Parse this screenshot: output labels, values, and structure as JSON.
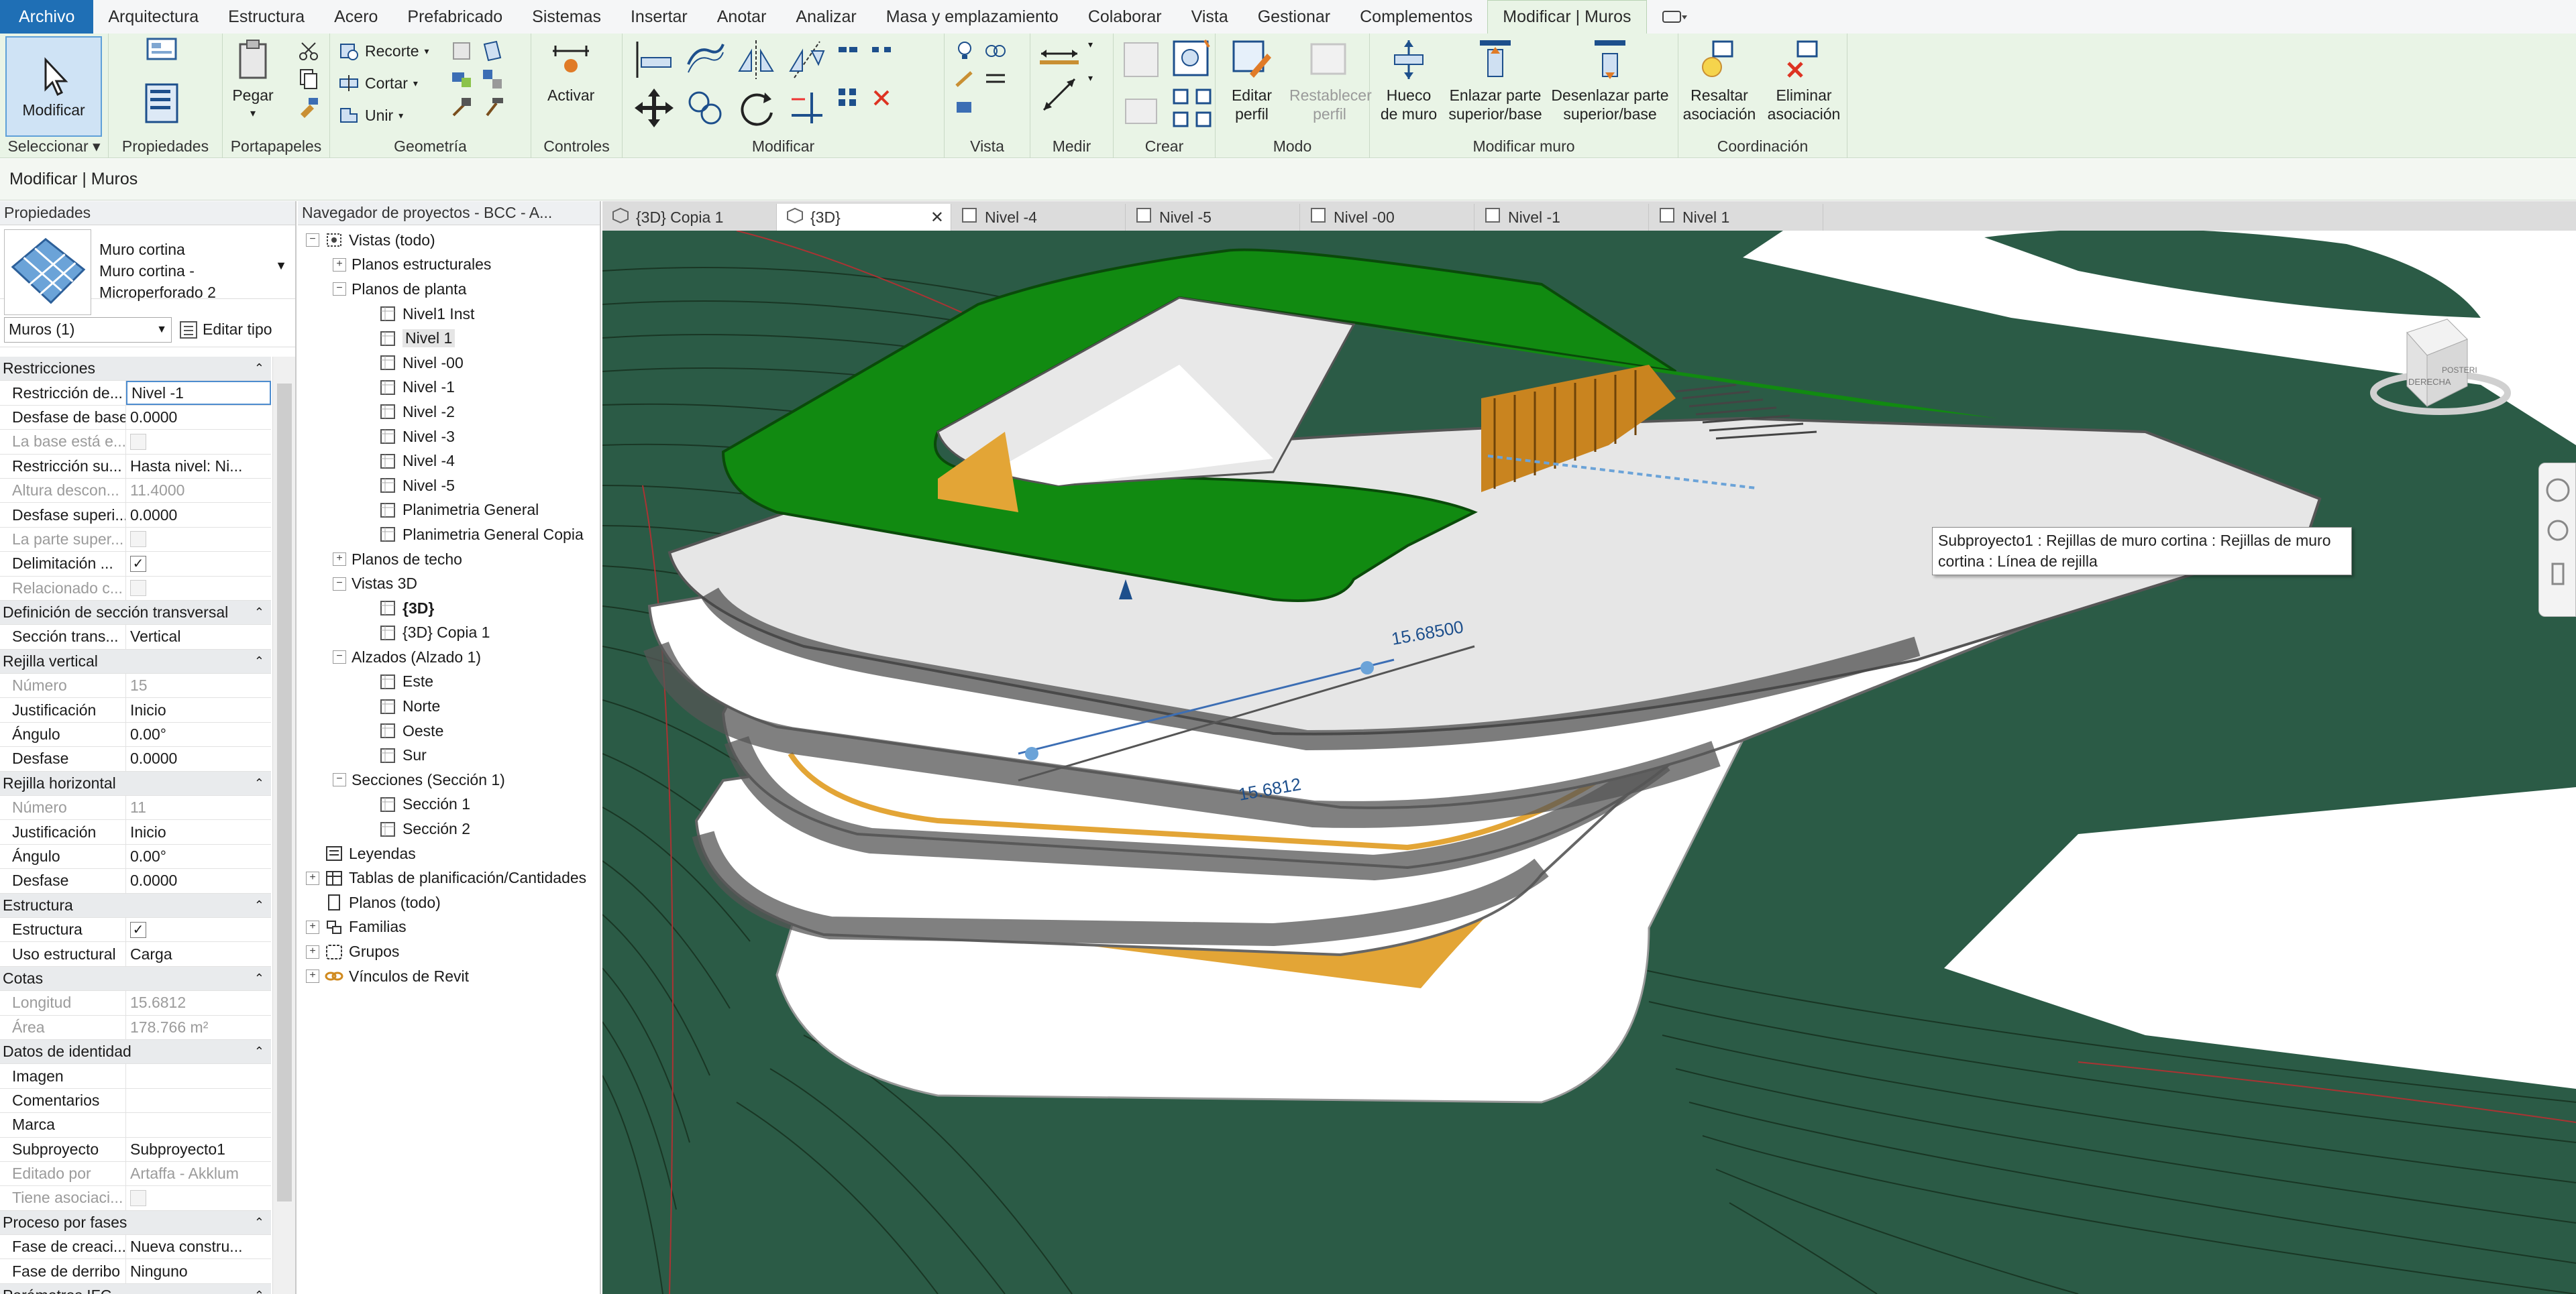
{
  "menu": {
    "tabs": [
      "Archivo",
      "Arquitectura",
      "Estructura",
      "Acero",
      "Prefabricado",
      "Sistemas",
      "Insertar",
      "Anotar",
      "Analizar",
      "Masa y emplazamiento",
      "Colaborar",
      "Vista",
      "Gestionar",
      "Complementos",
      "Modificar | Muros"
    ],
    "active": "Modificar | Muros"
  },
  "ribbon": {
    "select": {
      "button": "Modificar",
      "label": "Seleccionar"
    },
    "properties": {
      "label": "Propiedades"
    },
    "clipboard": {
      "paste": "Pegar",
      "label": "Portapapeles"
    },
    "geometry": {
      "cut": "Recorte",
      "cope": "Cortar",
      "join": "Unir",
      "label": "Geometría"
    },
    "controls": {
      "activate": "Activar",
      "label": "Controles"
    },
    "modify": {
      "label": "Modificar"
    },
    "view": {
      "label": "Vista"
    },
    "measure": {
      "label": "Medir"
    },
    "create": {
      "label": "Crear"
    },
    "mode": {
      "edit_profile": "Editar perfil",
      "reset_profile": "Restablecer perfil",
      "label": "Modo"
    },
    "modify_wall": {
      "wall_opening": "Hueco de muro",
      "attach": "Enlazar parte superior/base",
      "detach": "Desenlazar parte superior/base",
      "label": "Modificar muro"
    },
    "coordination": {
      "highlight": "Resaltar asociación",
      "remove": "Eliminar asociación",
      "label": "Coordinación"
    }
  },
  "context_bar": "Modificar | Muros",
  "properties": {
    "title": "Propiedades",
    "type_name": [
      "Muro cortina",
      "Muro cortina -",
      "Microperforado 2"
    ],
    "filter": "Muros (1)",
    "edit_type": "Editar tipo",
    "rows": [
      {
        "kind": "section",
        "label": "Restricciones"
      },
      {
        "k": "Restricción de...",
        "v": "Nivel -1",
        "edit": true
      },
      {
        "k": "Desfase de base",
        "v": "0.0000"
      },
      {
        "k": "La base está e...",
        "cb": "dis",
        "dim": true
      },
      {
        "k": "Restricción su...",
        "v": "Hasta nivel: Ni..."
      },
      {
        "k": "Altura descon...",
        "v": "11.4000",
        "dim": true
      },
      {
        "k": "Desfase superi...",
        "v": "0.0000"
      },
      {
        "k": "La parte super...",
        "cb": "dis",
        "dim": true
      },
      {
        "k": "Delimitación ...",
        "cb": "on"
      },
      {
        "k": "Relacionado c...",
        "cb": "dis",
        "dim": true
      },
      {
        "kind": "section",
        "label": "Definición de sección transversal"
      },
      {
        "k": "Sección trans...",
        "v": "Vertical"
      },
      {
        "kind": "section",
        "label": "Rejilla vertical"
      },
      {
        "k": "Número",
        "v": "15",
        "dim": true
      },
      {
        "k": "Justificación",
        "v": "Inicio"
      },
      {
        "k": "Ángulo",
        "v": "0.00°"
      },
      {
        "k": "Desfase",
        "v": "0.0000"
      },
      {
        "kind": "section",
        "label": "Rejilla horizontal"
      },
      {
        "k": "Número",
        "v": "11",
        "dim": true
      },
      {
        "k": "Justificación",
        "v": "Inicio"
      },
      {
        "k": "Ángulo",
        "v": "0.00°"
      },
      {
        "k": "Desfase",
        "v": "0.0000"
      },
      {
        "kind": "section",
        "label": "Estructura"
      },
      {
        "k": "Estructura",
        "cb": "on"
      },
      {
        "k": "Uso estructural",
        "v": "Carga"
      },
      {
        "kind": "section",
        "label": "Cotas"
      },
      {
        "k": "Longitud",
        "v": "15.6812",
        "dim": true
      },
      {
        "k": "Área",
        "v": "178.766 m²",
        "dim": true
      },
      {
        "kind": "section",
        "label": "Datos de identidad"
      },
      {
        "k": "Imagen",
        "v": ""
      },
      {
        "k": "Comentarios",
        "v": ""
      },
      {
        "k": "Marca",
        "v": ""
      },
      {
        "k": "Subproyecto",
        "v": "Subproyecto1"
      },
      {
        "k": "Editado por",
        "v": "Artaffa - Akklum",
        "dim": true
      },
      {
        "k": "Tiene asociaci...",
        "cb": "dis",
        "dim": true
      },
      {
        "kind": "section",
        "label": "Proceso por fases"
      },
      {
        "k": "Fase de creaci...",
        "v": "Nueva constru..."
      },
      {
        "k": "Fase de derribo",
        "v": "Ninguno"
      },
      {
        "kind": "section",
        "label": "Parámetros IFC"
      }
    ]
  },
  "browser": {
    "title": "Navegador de proyectos - BCC - A...",
    "nodes": [
      {
        "label": "Vistas (todo)",
        "lvl": 0,
        "exp": "−",
        "icon": "views"
      },
      {
        "label": "Planos estructurales",
        "lvl": 1,
        "exp": "+"
      },
      {
        "label": "Planos de planta",
        "lvl": 1,
        "exp": "−"
      },
      {
        "label": "Nivel1 Inst",
        "lvl": 2,
        "icon": "plan"
      },
      {
        "label": "Nivel 1",
        "lvl": 2,
        "icon": "plan",
        "sel": true
      },
      {
        "label": "Nivel -00",
        "lvl": 2,
        "icon": "plan"
      },
      {
        "label": "Nivel -1",
        "lvl": 2,
        "icon": "plan"
      },
      {
        "label": "Nivel -2",
        "lvl": 2,
        "icon": "plan"
      },
      {
        "label": "Nivel -3",
        "lvl": 2,
        "icon": "plan"
      },
      {
        "label": "Nivel -4",
        "lvl": 2,
        "icon": "plan"
      },
      {
        "label": "Nivel -5",
        "lvl": 2,
        "icon": "plan"
      },
      {
        "label": "Planimetria General",
        "lvl": 2,
        "icon": "plan"
      },
      {
        "label": "Planimetria General Copia",
        "lvl": 2,
        "icon": "plan"
      },
      {
        "label": "Planos de techo",
        "lvl": 1,
        "exp": "+"
      },
      {
        "label": "Vistas 3D",
        "lvl": 1,
        "exp": "−"
      },
      {
        "label": "{3D}",
        "lvl": 2,
        "icon": "plan",
        "bold": true
      },
      {
        "label": "{3D} Copia 1",
        "lvl": 2,
        "icon": "plan"
      },
      {
        "label": "Alzados (Alzado 1)",
        "lvl": 1,
        "exp": "−"
      },
      {
        "label": "Este",
        "lvl": 2,
        "icon": "plan"
      },
      {
        "label": "Norte",
        "lvl": 2,
        "icon": "plan"
      },
      {
        "label": "Oeste",
        "lvl": 2,
        "icon": "plan"
      },
      {
        "label": "Sur",
        "lvl": 2,
        "icon": "plan"
      },
      {
        "label": "Secciones (Sección 1)",
        "lvl": 1,
        "exp": "−"
      },
      {
        "label": "Sección 1",
        "lvl": 2,
        "icon": "plan"
      },
      {
        "label": "Sección 2",
        "lvl": 2,
        "icon": "plan"
      },
      {
        "label": "Leyendas",
        "lvl": 0,
        "icon": "legend"
      },
      {
        "label": "Tablas de planificación/Cantidades",
        "lvl": 0,
        "exp": "+",
        "icon": "table"
      },
      {
        "label": "Planos (todo)",
        "lvl": 0,
        "icon": "sheet"
      },
      {
        "label": "Familias",
        "lvl": 0,
        "exp": "+",
        "icon": "family"
      },
      {
        "label": "Grupos",
        "lvl": 0,
        "exp": "+",
        "icon": "group"
      },
      {
        "label": "Vínculos de Revit",
        "lvl": 0,
        "exp": "+",
        "icon": "link"
      }
    ]
  },
  "view_tabs": [
    {
      "label": "{3D} Copia 1"
    },
    {
      "label": "{3D}",
      "active": true
    },
    {
      "label": "Nivel -4"
    },
    {
      "label": "Nivel -5"
    },
    {
      "label": "Nivel -00"
    },
    {
      "label": "Nivel -1"
    },
    {
      "label": "Nivel 1"
    }
  ],
  "viewport": {
    "tooltip": [
      "Subproyecto1 : Rejillas de muro cortina : Rejillas de muro",
      "cortina : Línea de rejilla"
    ],
    "dim_a": "15.6812",
    "dim_b": "15.68500",
    "viewcube_label": "DERECHA",
    "viewcube_label2": "POSTERI"
  },
  "colors": {
    "terrain": "#2b5b46",
    "roof_green": "#118a11",
    "accent_orange": "#e3a536",
    "ribbon_bg": "#e9f4e6",
    "file_tab": "#1f6fb5"
  }
}
